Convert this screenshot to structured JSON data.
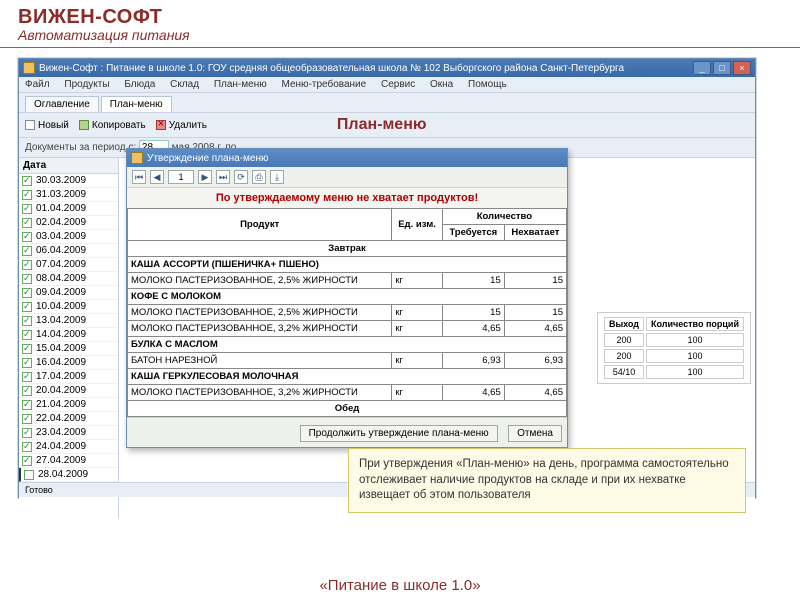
{
  "brand": "ВИЖЕН-СОФТ",
  "subtitle": "Автоматизация питания",
  "footer": "«Питание в школе 1.0»",
  "app": {
    "title": "Вижен-Софт : Питание в школе 1.0: ГОУ средняя общеобразовательная школа № 102 Выборгского района Санкт-Петербурга",
    "menu": [
      "Файл",
      "Продукты",
      "Блюда",
      "Склад",
      "План-меню",
      "Меню-требование",
      "Сервис",
      "Окна",
      "Помощь"
    ],
    "tabs": [
      "Оглавление",
      "План-меню"
    ],
    "active_tab": 1,
    "toolbar": {
      "new": "Новый",
      "copy": "Копировать",
      "delete": "Удалить"
    },
    "big_title": "План-меню",
    "period_label": "Документы за период с:",
    "period_day": "28",
    "period_month": "мая",
    "period_year": "2008 г.",
    "period_to": "по",
    "dates_header": "Дата",
    "dates": [
      "30.03.2009",
      "31.03.2009",
      "01.04.2009",
      "02.04.2009",
      "03.04.2009",
      "06.04.2009",
      "07.04.2009",
      "08.04.2009",
      "09.04.2009",
      "10.04.2009",
      "13.04.2009",
      "14.04.2009",
      "15.04.2009",
      "16.04.2009",
      "17.04.2009",
      "20.04.2009",
      "21.04.2009",
      "22.04.2009",
      "23.04.2009",
      "24.04.2009",
      "27.04.2009",
      "28.04.2009"
    ],
    "selected_date_idx": 21,
    "right_headers": [
      "Выход",
      "Количество порций"
    ],
    "right_rows": [
      [
        "200",
        "100"
      ],
      [
        "200",
        "100"
      ],
      [
        "54/10",
        "100"
      ]
    ],
    "status": "Готово"
  },
  "popup": {
    "title": "Утверждение плана-меню",
    "page": "1",
    "warning": "По утверждаемому меню не хватает продуктов!",
    "headers": {
      "product": "Продукт",
      "unit": "Ед. изм.",
      "qty": "Количество",
      "req": "Требуется",
      "short": "Нехватает"
    },
    "sections": {
      "breakfast": "Завтрак",
      "lunch": "Обед"
    },
    "rows": [
      {
        "bold": true,
        "product": "КАША  АССОРТИ  (ПШЕНИЧКА+ ПШЕНО)"
      },
      {
        "product": "МОЛОКО ПАСТЕРИЗОВАННОЕ, 2,5% ЖИРНОСТИ",
        "unit": "кг",
        "req": "15",
        "short": "15"
      },
      {
        "bold": true,
        "product": "КОФЕ С МОЛОКОМ"
      },
      {
        "product": "МОЛОКО ПАСТЕРИЗОВАННОЕ, 2,5% ЖИРНОСТИ",
        "unit": "кг",
        "req": "15",
        "short": "15"
      },
      {
        "product": "МОЛОКО ПАСТЕРИЗОВАННОЕ, 3,2% ЖИРНОСТИ",
        "unit": "кг",
        "req": "4,65",
        "short": "4,65"
      },
      {
        "bold": true,
        "product": "БУЛКА С МАСЛОМ"
      },
      {
        "product": "БАТОН НАРЕЗНОЙ",
        "unit": "кг",
        "req": "6,93",
        "short": "6,93"
      },
      {
        "bold": true,
        "product": "КАША  ГЕРКУЛЕСОВАЯ  МОЛОЧНАЯ"
      },
      {
        "product": "МОЛОКО ПАСТЕРИЗОВАННОЕ, 3,2% ЖИРНОСТИ",
        "unit": "кг",
        "req": "4,65",
        "short": "4,65"
      }
    ],
    "btn_continue": "Продолжить утверждение плана-меню",
    "btn_cancel": "Отмена"
  },
  "callout": "При утверждения «План-меню» на день, программа самостоятельно отслеживает наличие продуктов на складе и при их нехватке извещает об этом пользователя"
}
